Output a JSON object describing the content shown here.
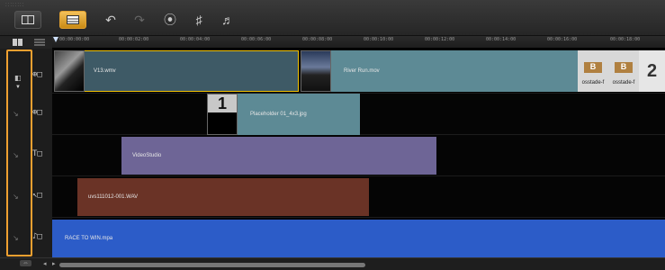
{
  "toolbar": {
    "grip": "::::::::",
    "buttons": [
      {
        "name": "storyboard-view",
        "icon": "storyboard-icon"
      },
      {
        "name": "timeline-view",
        "icon": "timeline-icon",
        "active": true
      }
    ],
    "tools": [
      {
        "name": "undo",
        "glyph": "↶"
      },
      {
        "name": "redo",
        "glyph": "↷"
      },
      {
        "name": "record-capture",
        "glyph": "⦿"
      },
      {
        "name": "sound-mixer",
        "glyph": "♯"
      },
      {
        "name": "auto-music",
        "glyph": "♬"
      }
    ]
  },
  "ruler": {
    "labels": [
      "00:00:00:00",
      "00:00:02:00",
      "00:00:04:00",
      "00:00:06:00",
      "00:00:08:00",
      "00:00:10:00",
      "00:00:12:00",
      "00:00:14:00",
      "00:00:16:00",
      "00:00:18:00"
    ]
  },
  "tracks": [
    {
      "name": "video-track",
      "type": "video",
      "icon": "video-track-icon"
    },
    {
      "name": "overlay-track",
      "type": "overlay",
      "icon": "overlay-track-icon"
    },
    {
      "name": "title-track",
      "type": "title",
      "icon": "title-track-icon"
    },
    {
      "name": "voice-track",
      "type": "voice",
      "icon": "voice-track-icon"
    },
    {
      "name": "music-track",
      "type": "music",
      "icon": "music-track-icon"
    }
  ],
  "clips": {
    "v13": "V13.wmv",
    "river": "River Run.mov",
    "transition1": "osstade-f",
    "transition2": "osstade-f",
    "placeholder_num": "1",
    "placeholder": "Placeholder 01_4x3.jpg",
    "title": "VideoStudio",
    "voice": "uvs111012-001.WAV",
    "music": "RACE TO WIN.mpa",
    "transition_num": "2"
  },
  "colors": {
    "highlight": "#f0a030",
    "video_clip": "#3e5a66",
    "overlay_clip": "#5d8a95",
    "title_clip": "#6e6596",
    "voice_clip": "#6a3326",
    "music_clip": "#2c5cc8"
  }
}
